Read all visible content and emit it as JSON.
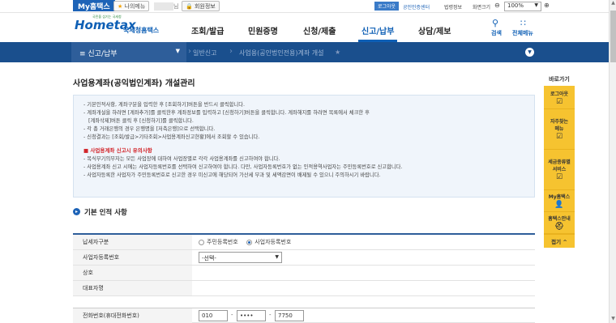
{
  "topbar": {
    "my_hometax": "My홈택스",
    "my_menu": "나의메뉴",
    "name_suffix": "님",
    "member_info": "회원정보",
    "logout": "로그아웃",
    "cert_center": "공인인증센터",
    "law_info": "법령정보",
    "screen_size": "화면크기",
    "zoom": "100%"
  },
  "header": {
    "logo_text": "Hometax",
    "logo_nts": "국세청홈택스",
    "logo_sub": "국민을 섬기는 국세청",
    "gnb": [
      "조회/발급",
      "민원증명",
      "신청/제출",
      "신고/납부",
      "상담/제보"
    ],
    "search": "검색",
    "all_menu": "전체메뉴"
  },
  "locbar": {
    "current": "신고/납부",
    "items": [
      "일반신고",
      "사업용(공인법인전용)계좌 개설"
    ]
  },
  "main": {
    "title": "사업용계좌(공익법인계좌) 개설관리",
    "notice_lines": [
      "기본인적사항, 계좌구분을 입력한 후 [조회하기]버튼을 반드시 클릭합니다.",
      "계좌개설을 하려면 [계좌추가]를 클릭한후 계좌정보를 입력하고 [신청하기]버튼을 클릭합니다. 계좌해지를 하려면 목록에서 체크한 후",
      "[계좌삭제]버튼 클릭 후 [신청하기]를 클릭합니다.",
      "각 총 거래은행의 경우 은행명을 [저축은행]으로 선택합니다.",
      "신청결과는 [조회/발급>기타조회>사업용계좌신고현황]에서 조회할 수 있습니다."
    ],
    "warn_title": "사업용계좌 신고시 유의사항",
    "warn_lines": [
      "복식부기의무자는 모든 사업장에 대하여 사업장별로 각각 사업용계좌를 신고하여야 합니다.",
      "사업용계좌 신고 시에는 사업자등록번호를 선택하여 신고하여야 합니다. 다만, 사업자등록번호가 없는 인적용역사업자는 주민등록번호로 신고합니다.",
      "사업자등록한 사업자가 주민등록번호로 신고한 경우 미신고에 해당되어 가산세 부과 및 세액감면이 배제될 수 있으니 주의하시기 바랍니다."
    ],
    "section_title": "기본 인적 사항"
  },
  "form": {
    "taxpayer_type_label": "납세자구분",
    "radio_resident": "주민등록번호",
    "radio_business": "사업자등록번호",
    "business_no_label": "사업자등록번호",
    "business_no_select": "-선택-",
    "company_label": "상호",
    "rep_label": "대표자명",
    "phone_label": "전화번호(휴대전화번호)",
    "phone1": "010",
    "phone2": "••••",
    "phone3": "7750"
  },
  "quickbar": {
    "title": "바로가기",
    "items": [
      "로그아웃",
      "자주찾는\n메뉴",
      "세금종류별\n서비스",
      "My홈택스",
      "홈택스안내"
    ],
    "close": "접기"
  }
}
